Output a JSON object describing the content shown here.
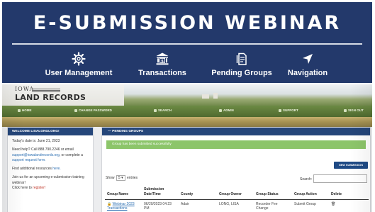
{
  "banner": {
    "title": "E-SUBMISSION WEBINAR",
    "features": [
      {
        "label": "User Management",
        "icon": "gear-icon"
      },
      {
        "label": "Transactions",
        "icon": "bank-icon"
      },
      {
        "label": "Pending Groups",
        "icon": "document-icon"
      },
      {
        "label": "Navigation",
        "icon": "arrow-cursor-icon"
      }
    ]
  },
  "site": {
    "logo_top": "IOWA",
    "logo_main": "LAND RECORDS",
    "nav": [
      "HOME",
      "CHANGE PASSWORD",
      "SEARCH",
      "ADMIN",
      "SUPPORT",
      "SIGN OUT"
    ]
  },
  "welcome": {
    "header": "WELCOME LISALONGLONG!",
    "date_line": "Today's date is: June 21, 2023",
    "help_pre": "Need help? Call 888.790.2246 or email",
    "help_email": "support@iowalandrecords.org",
    "help_mid": ", or complete a",
    "help_link": "support request form.",
    "resources_pre": "Find additional resources",
    "resources_link": "here.",
    "training_pre": "Join us for an upcoming e-submission training webinar!",
    "training_click": "Click here to",
    "training_link": "register!"
  },
  "pending": {
    "header": "PENDING GROUPS",
    "alert": "Group has been submitted successfully",
    "new_button": "NEW SUBMISSION",
    "show_label": "Show",
    "show_value": "5",
    "entries_label": "entries",
    "search_label": "Search:",
    "columns": [
      "Group Name",
      "Submission Date/Time",
      "County",
      "Group Owner",
      "Group Status",
      "Group Action",
      "Delete"
    ],
    "rows": [
      {
        "group_name": "Webinar 2023 Transactions",
        "datetime": "06/20/2023 04:23 PM",
        "county": "Adair",
        "owner": "LONG, LISA",
        "status": "Recorder Fee Change",
        "action": "Submit Group"
      }
    ]
  }
}
